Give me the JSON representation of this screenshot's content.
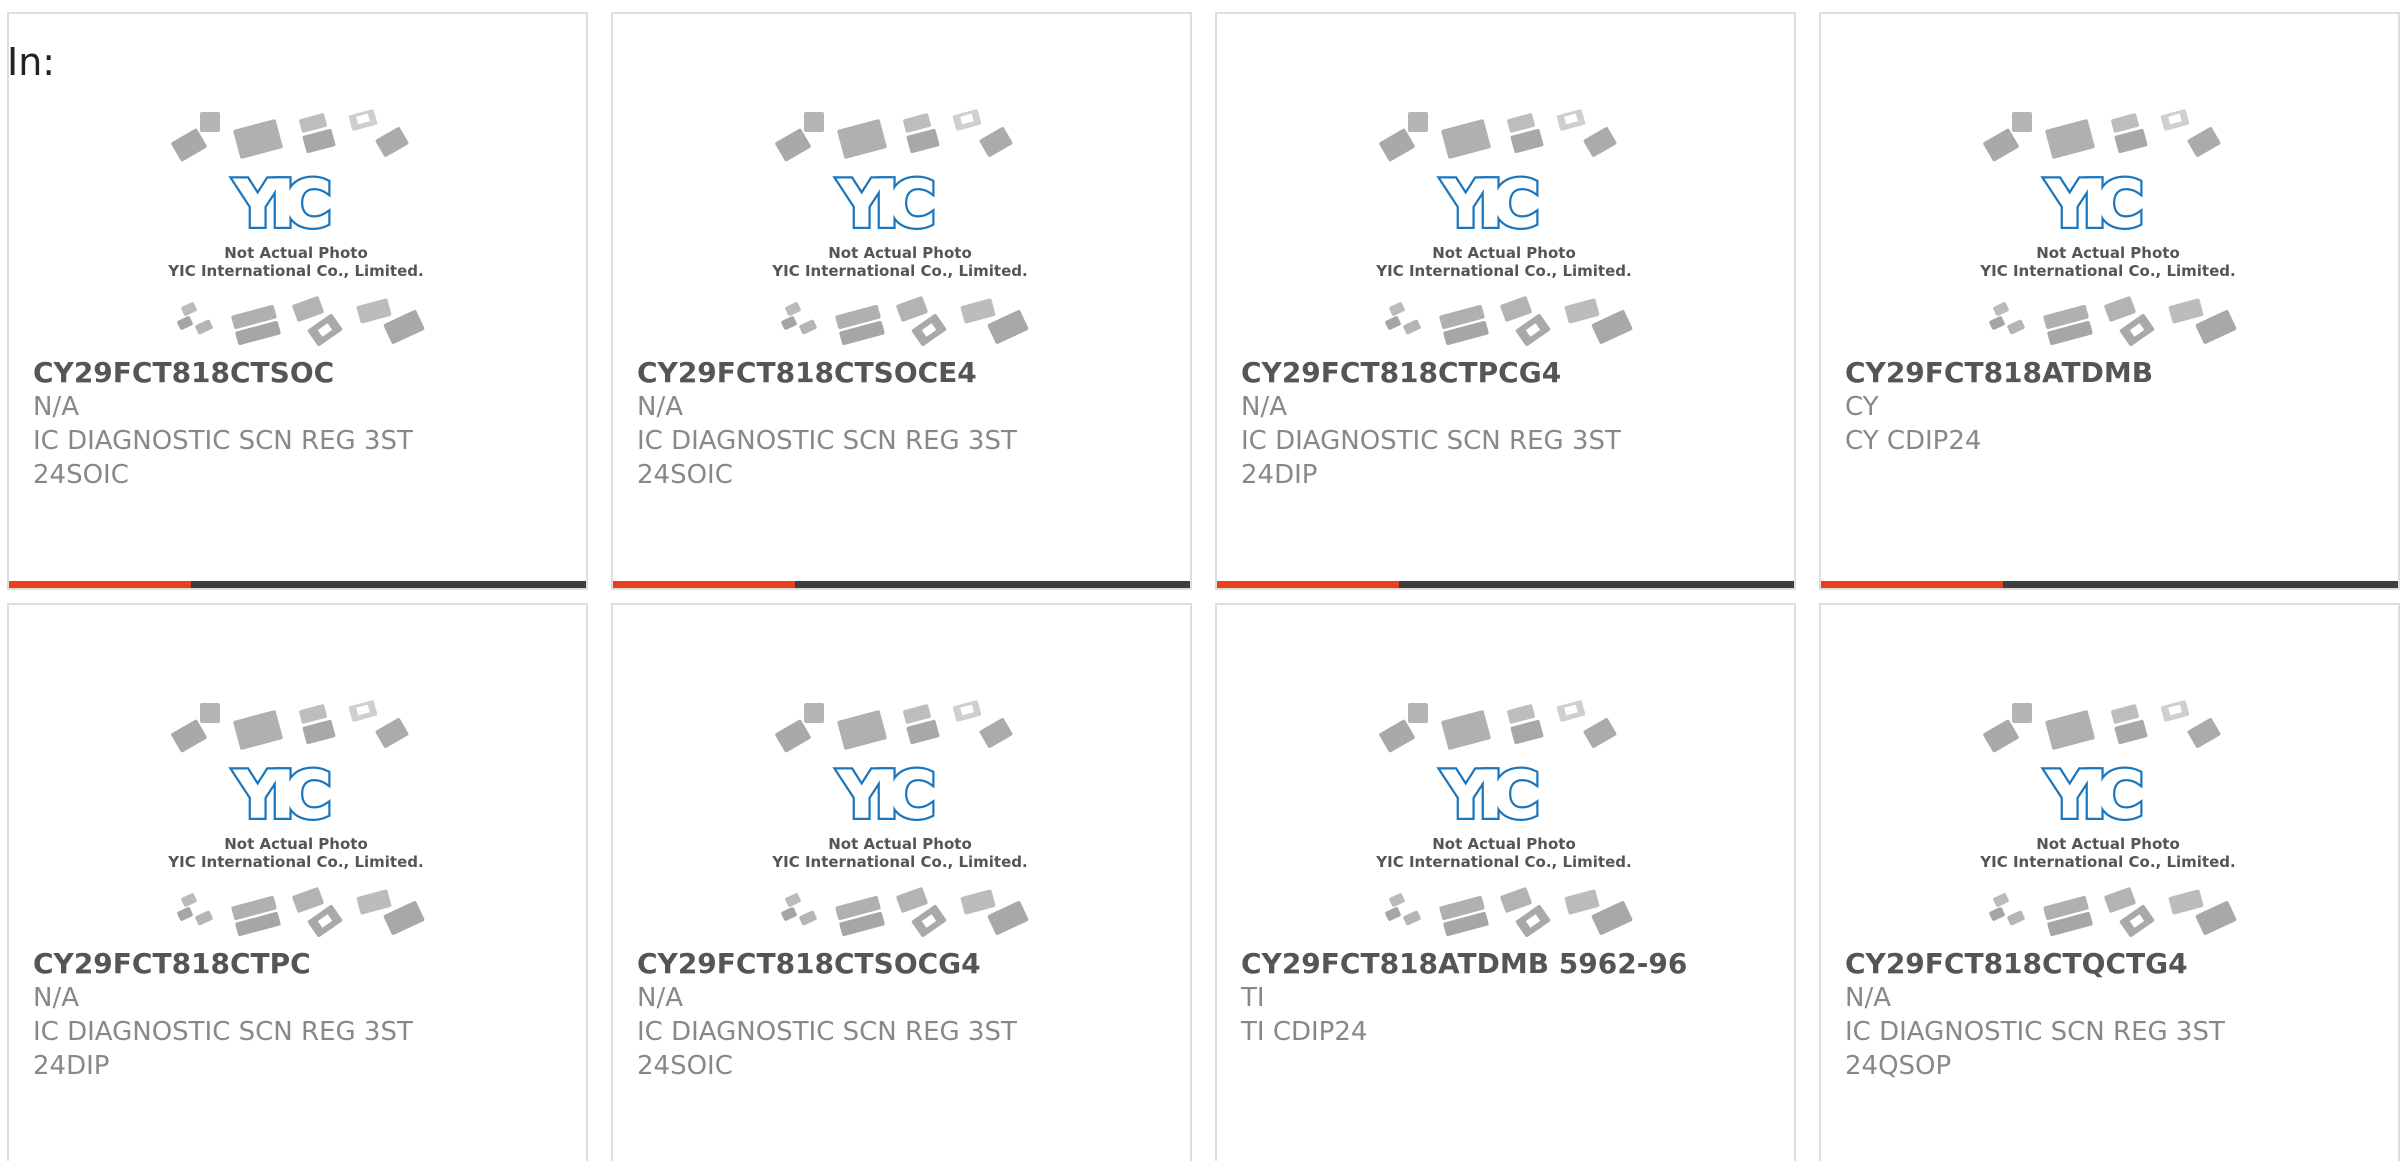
{
  "header": {
    "label": "In:"
  },
  "placeholder": {
    "logo_text": "YIC",
    "caption_line1": "Not Actual Photo",
    "caption_line2": "YIC International Co., Limited."
  },
  "colors": {
    "accent": "#e8401c",
    "bar": "#3d3d3d",
    "logo_blue": "#1b76bc"
  },
  "products": [
    {
      "part": "CY29FCT818CTSOC",
      "mfr": "N/A",
      "desc1": "IC DIAGNOSTIC SCN REG 3ST",
      "desc2": "24SOIC"
    },
    {
      "part": "CY29FCT818CTSOCE4",
      "mfr": "N/A",
      "desc1": "IC DIAGNOSTIC SCN REG 3ST",
      "desc2": "24SOIC"
    },
    {
      "part": "CY29FCT818CTPCG4",
      "mfr": "N/A",
      "desc1": "IC DIAGNOSTIC SCN REG 3ST",
      "desc2": "24DIP"
    },
    {
      "part": "CY29FCT818ATDMB",
      "mfr": "CY",
      "desc1": "CY CDIP24",
      "desc2": ""
    },
    {
      "part": "CY29FCT818CTPC",
      "mfr": "N/A",
      "desc1": "IC DIAGNOSTIC SCN REG 3ST",
      "desc2": "24DIP"
    },
    {
      "part": "CY29FCT818CTSOCG4",
      "mfr": "N/A",
      "desc1": "IC DIAGNOSTIC SCN REG 3ST",
      "desc2": "24SOIC"
    },
    {
      "part": "CY29FCT818ATDMB 5962-96",
      "mfr": "TI",
      "desc1": "TI CDIP24",
      "desc2": ""
    },
    {
      "part": "CY29FCT818CTQCTG4",
      "mfr": "N/A",
      "desc1": "IC DIAGNOSTIC SCN REG 3ST",
      "desc2": "24QSOP"
    }
  ]
}
